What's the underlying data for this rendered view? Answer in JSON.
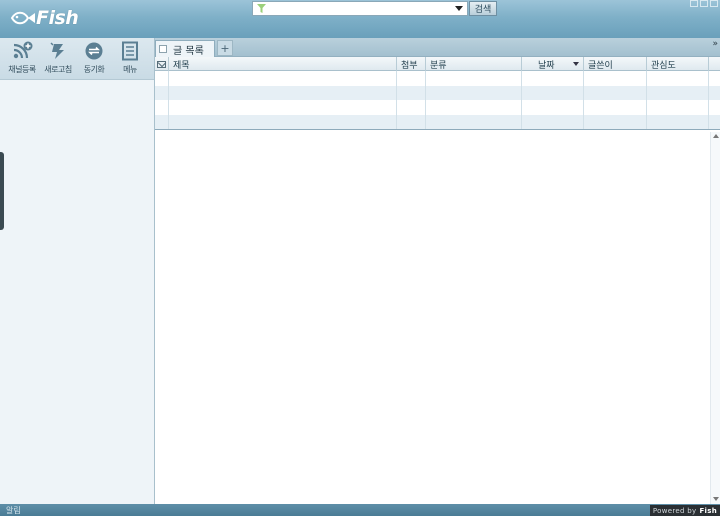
{
  "app": {
    "logo_text": "Fish"
  },
  "search": {
    "placeholder": "",
    "button_label": "검색"
  },
  "toolbar": {
    "items": [
      {
        "label": "채널등록",
        "icon": "rss-add-icon"
      },
      {
        "label": "새로고침",
        "icon": "refresh-icon"
      },
      {
        "label": "동기화",
        "icon": "sync-icon"
      },
      {
        "label": "메뉴",
        "icon": "menu-list-icon"
      }
    ]
  },
  "tabs": {
    "active_label": "글 목록",
    "add_label": "+",
    "scroll_label": "»"
  },
  "table": {
    "columns": [
      "제목",
      "첨부",
      "분류",
      "날짜",
      "글쓴이",
      "관심도"
    ],
    "rows": 4
  },
  "status": {
    "text": "알림",
    "powered_prefix": "Powered by",
    "powered_brand": "Fish"
  },
  "colors": {
    "titlebar": "#7fb0c8",
    "sidebar_bg": "#eef4f8",
    "status_bar": "#4a7b95",
    "row_alt": "#e6eff5"
  }
}
